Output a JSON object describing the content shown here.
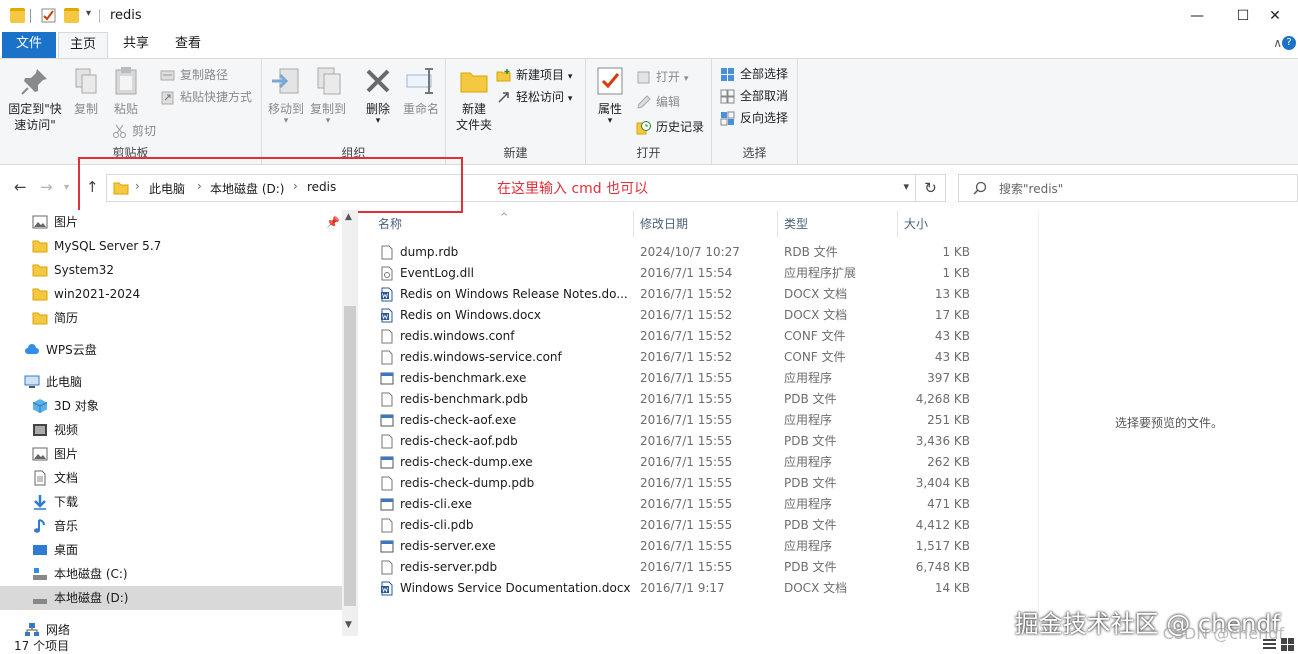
{
  "window": {
    "title": "redis",
    "minimize_glyph": "—",
    "maximize_glyph": "☐",
    "close_glyph": "✕"
  },
  "tabs": {
    "file": "文件",
    "home": "主页",
    "share": "共享",
    "view": "查看",
    "collapse_glyph": "∧",
    "help_glyph": "?"
  },
  "ribbon": {
    "clipboard": {
      "label": "剪贴板",
      "pin_line1": "固定到\"快",
      "pin_line2": "速访问\"",
      "copy": "复制",
      "paste": "粘贴",
      "copy_path": "复制路径",
      "paste_shortcut": "粘贴快捷方式",
      "cut": "剪切"
    },
    "organize": {
      "label": "组织",
      "move_to": "移动到",
      "copy_to": "复制到",
      "delete": "删除",
      "rename": "重命名"
    },
    "new": {
      "label": "新建",
      "new_folder_line1": "新建",
      "new_folder_line2": "文件夹",
      "new_item": "新建项目",
      "easy_access": "轻松访问"
    },
    "open": {
      "label": "打开",
      "properties": "属性",
      "open": "打开",
      "edit": "编辑",
      "history": "历史记录"
    },
    "select": {
      "label": "选择",
      "select_all": "全部选择",
      "select_none": "全部取消",
      "invert": "反向选择"
    }
  },
  "address": {
    "crumbs": [
      "此电脑",
      "本地磁盘 (D:)",
      "redis"
    ],
    "search_placeholder": "搜索\"redis\"",
    "annotation": "在这里输入 cmd 也可以"
  },
  "nav": {
    "items": [
      {
        "label": "图片",
        "icon": "pictures-icon"
      },
      {
        "label": "MySQL Server 5.7",
        "icon": "folder-icon"
      },
      {
        "label": "System32",
        "icon": "folder-icon"
      },
      {
        "label": "win2021-2024",
        "icon": "folder-icon"
      },
      {
        "label": "简历",
        "icon": "folder-icon"
      },
      {
        "label": "WPS云盘",
        "icon": "cloud-icon"
      },
      {
        "label": "此电脑",
        "icon": "computer-icon"
      },
      {
        "label": "3D 对象",
        "icon": "3d-objects-icon"
      },
      {
        "label": "视频",
        "icon": "video-icon"
      },
      {
        "label": "图片",
        "icon": "pictures-icon"
      },
      {
        "label": "文档",
        "icon": "documents-icon"
      },
      {
        "label": "下载",
        "icon": "download-icon"
      },
      {
        "label": "音乐",
        "icon": "music-icon"
      },
      {
        "label": "桌面",
        "icon": "desktop-icon"
      },
      {
        "label": "本地磁盘 (C:)",
        "icon": "drive-c-icon"
      },
      {
        "label": "本地磁盘 (D:)",
        "icon": "drive-d-icon"
      },
      {
        "label": "网络",
        "icon": "network-icon"
      }
    ]
  },
  "columns": {
    "name": "名称",
    "date": "修改日期",
    "type": "类型",
    "size": "大小"
  },
  "files": [
    {
      "name": "dump.rdb",
      "date": "2024/10/7 10:27",
      "type": "RDB 文件",
      "size": "1 KB",
      "icon": "file-icon"
    },
    {
      "name": "EventLog.dll",
      "date": "2016/7/1 15:54",
      "type": "应用程序扩展",
      "size": "1 KB",
      "icon": "dll-icon"
    },
    {
      "name": "Redis on Windows Release Notes.do...",
      "date": "2016/7/1 15:52",
      "type": "DOCX 文档",
      "size": "13 KB",
      "icon": "word-icon"
    },
    {
      "name": "Redis on Windows.docx",
      "date": "2016/7/1 15:52",
      "type": "DOCX 文档",
      "size": "17 KB",
      "icon": "word-icon"
    },
    {
      "name": "redis.windows.conf",
      "date": "2016/7/1 15:52",
      "type": "CONF 文件",
      "size": "43 KB",
      "icon": "file-icon"
    },
    {
      "name": "redis.windows-service.conf",
      "date": "2016/7/1 15:52",
      "type": "CONF 文件",
      "size": "43 KB",
      "icon": "file-icon"
    },
    {
      "name": "redis-benchmark.exe",
      "date": "2016/7/1 15:55",
      "type": "应用程序",
      "size": "397 KB",
      "icon": "exe-icon"
    },
    {
      "name": "redis-benchmark.pdb",
      "date": "2016/7/1 15:55",
      "type": "PDB 文件",
      "size": "4,268 KB",
      "icon": "file-icon"
    },
    {
      "name": "redis-check-aof.exe",
      "date": "2016/7/1 15:55",
      "type": "应用程序",
      "size": "251 KB",
      "icon": "exe-icon"
    },
    {
      "name": "redis-check-aof.pdb",
      "date": "2016/7/1 15:55",
      "type": "PDB 文件",
      "size": "3,436 KB",
      "icon": "file-icon"
    },
    {
      "name": "redis-check-dump.exe",
      "date": "2016/7/1 15:55",
      "type": "应用程序",
      "size": "262 KB",
      "icon": "exe-icon"
    },
    {
      "name": "redis-check-dump.pdb",
      "date": "2016/7/1 15:55",
      "type": "PDB 文件",
      "size": "3,404 KB",
      "icon": "file-icon"
    },
    {
      "name": "redis-cli.exe",
      "date": "2016/7/1 15:55",
      "type": "应用程序",
      "size": "471 KB",
      "icon": "exe-icon"
    },
    {
      "name": "redis-cli.pdb",
      "date": "2016/7/1 15:55",
      "type": "PDB 文件",
      "size": "4,412 KB",
      "icon": "file-icon"
    },
    {
      "name": "redis-server.exe",
      "date": "2016/7/1 15:55",
      "type": "应用程序",
      "size": "1,517 KB",
      "icon": "exe-icon"
    },
    {
      "name": "redis-server.pdb",
      "date": "2016/7/1 15:55",
      "type": "PDB 文件",
      "size": "6,748 KB",
      "icon": "file-icon"
    },
    {
      "name": "Windows Service Documentation.docx",
      "date": "2016/7/1 9:17",
      "type": "DOCX 文档",
      "size": "14 KB",
      "icon": "word-icon"
    }
  ],
  "preview": {
    "text": "选择要预览的文件。"
  },
  "status": {
    "count": "17 个项目"
  },
  "watermark": {
    "main": "掘金技术社区 @ chendf",
    "sub": "CSDN @chendf"
  },
  "colors": {
    "accent": "#1a73c8",
    "annotation": "#e0313a",
    "folder": "#f5c842"
  }
}
